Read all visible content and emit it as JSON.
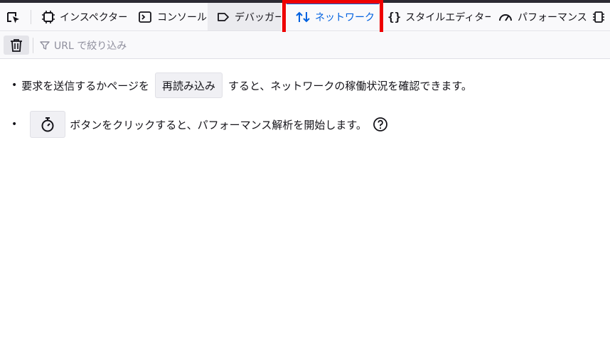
{
  "toolbar": {
    "tabs": [
      {
        "label": "インスペクター",
        "icon": "inspector-icon"
      },
      {
        "label": "コンソール",
        "icon": "console-icon"
      },
      {
        "label": "デバッガー",
        "icon": "debugger-icon"
      },
      {
        "label": "ネットワーク",
        "icon": "network-arrows-icon",
        "selected": true
      },
      {
        "label": "スタイルエディター",
        "icon": "braces-icon"
      },
      {
        "label": "パフォーマンス",
        "icon": "gauge-icon"
      }
    ],
    "accent_color": "#0061e0",
    "annotation_color": "#ee0000"
  },
  "filterbar": {
    "filter_placeholder": "URL で絞り込み"
  },
  "main": {
    "reload_text_before": "要求を送信するかページを",
    "reload_button_label": "再読み込み",
    "reload_text_after": "すると、ネットワークの稼働状況を確認できます。",
    "perf_text": "ボタンをクリックすると、パフォーマンス解析を開始します。"
  }
}
